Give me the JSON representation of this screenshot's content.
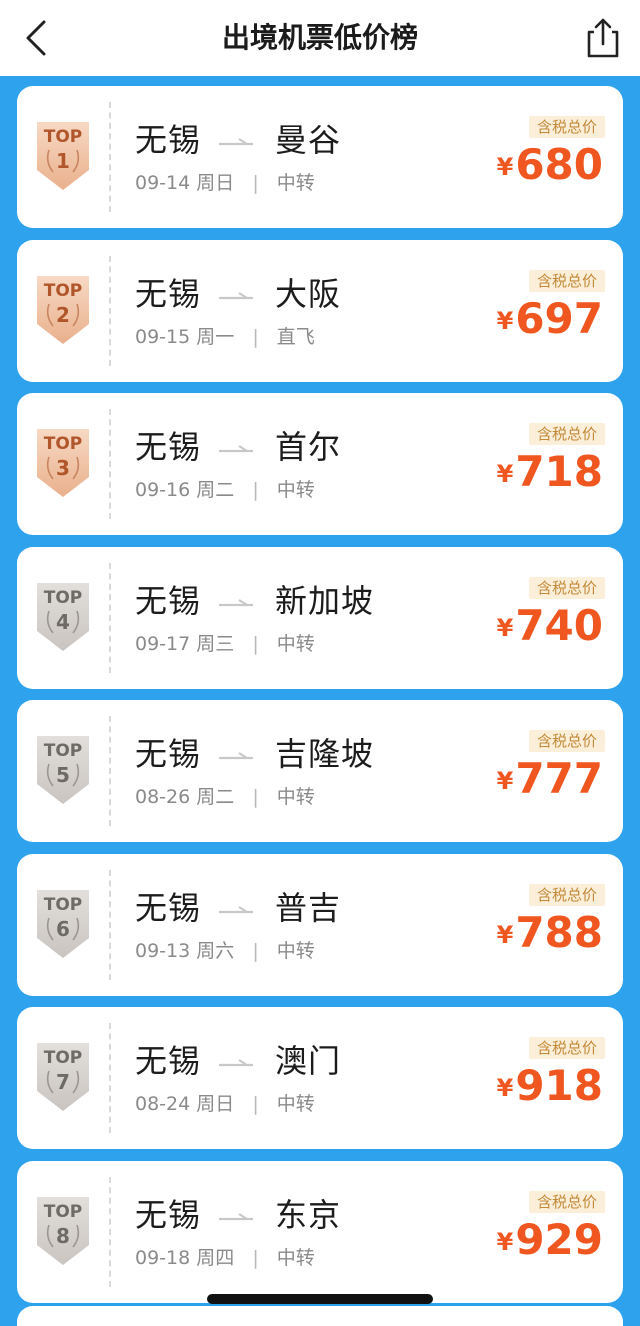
{
  "header": {
    "title": "出境机票低价榜",
    "back_icon": "chevron-left-icon",
    "share_icon": "share-icon"
  },
  "colors": {
    "background": "#2FA2EE",
    "price": "#F0561F",
    "badge_top": "#E9B08C",
    "badge_other": "#C9C4C0"
  },
  "tax_label": "含税总价",
  "currency": "¥",
  "badge_label": "TOP",
  "items": [
    {
      "rank": "1",
      "from": "无锡",
      "to": "曼谷",
      "date": "09-14",
      "weekday": "周日",
      "type": "中转",
      "price": "680"
    },
    {
      "rank": "2",
      "from": "无锡",
      "to": "大阪",
      "date": "09-15",
      "weekday": "周一",
      "type": "直飞",
      "price": "697"
    },
    {
      "rank": "3",
      "from": "无锡",
      "to": "首尔",
      "date": "09-16",
      "weekday": "周二",
      "type": "中转",
      "price": "718"
    },
    {
      "rank": "4",
      "from": "无锡",
      "to": "新加坡",
      "date": "09-17",
      "weekday": "周三",
      "type": "中转",
      "price": "740"
    },
    {
      "rank": "5",
      "from": "无锡",
      "to": "吉隆坡",
      "date": "08-26",
      "weekday": "周二",
      "type": "中转",
      "price": "777"
    },
    {
      "rank": "6",
      "from": "无锡",
      "to": "普吉",
      "date": "09-13",
      "weekday": "周六",
      "type": "中转",
      "price": "788"
    },
    {
      "rank": "7",
      "from": "无锡",
      "to": "澳门",
      "date": "08-24",
      "weekday": "周日",
      "type": "中转",
      "price": "918"
    },
    {
      "rank": "8",
      "from": "无锡",
      "to": "东京",
      "date": "09-18",
      "weekday": "周四",
      "type": "中转",
      "price": "929"
    }
  ]
}
